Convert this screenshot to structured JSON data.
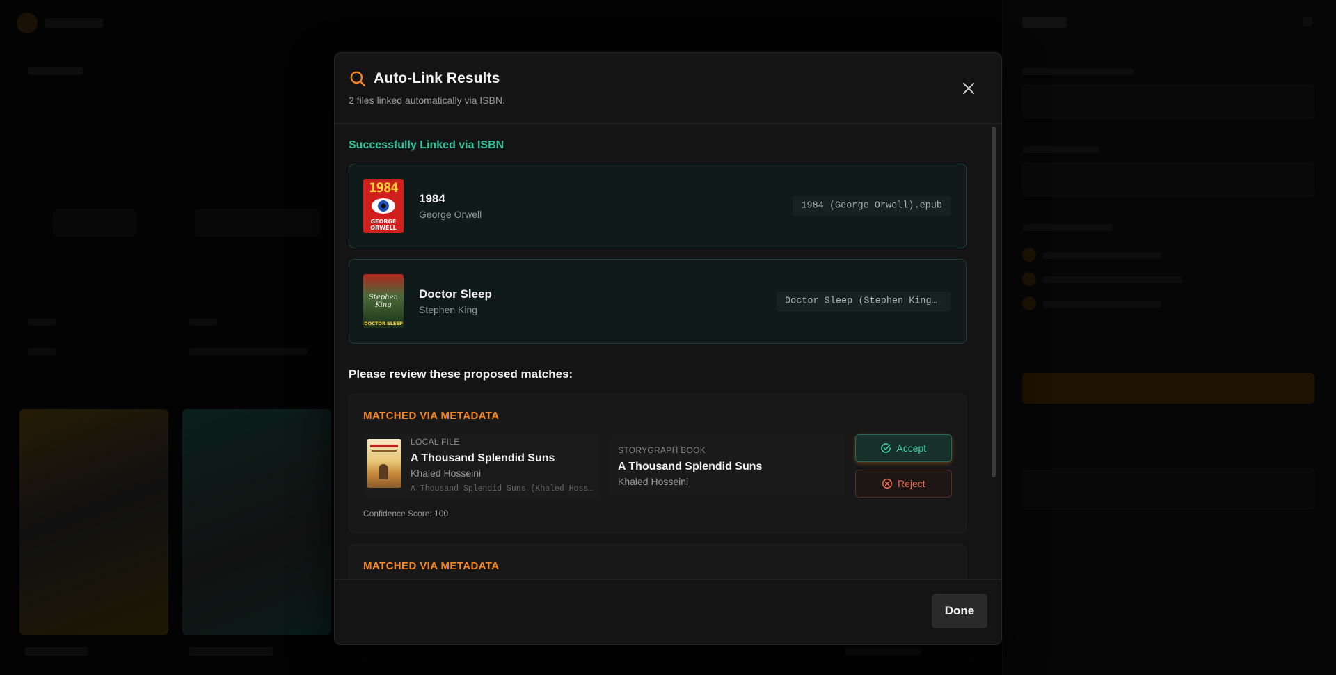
{
  "colors": {
    "accent": "#f5861f",
    "success": "#2fc29a",
    "reject": "#ef6b52"
  },
  "modal": {
    "title": "Auto-Link Results",
    "subtitle": "2 files linked automatically via ISBN.",
    "title_icon": "search-icon",
    "close_icon": "close-icon"
  },
  "linked": {
    "heading": "Successfully Linked via ISBN",
    "items": [
      {
        "title": "1984",
        "author": "George Orwell",
        "file": "1984 (George Orwell).epub",
        "cover_text_top": "1984",
        "cover_text_bottom": "GEORGE ORWELL"
      },
      {
        "title": "Doctor Sleep",
        "author": "Stephen King",
        "file": "Doctor Sleep (Stephen King).epub",
        "cover_text_top": "Stephen King",
        "cover_text_bottom": "DOCTOR SLEEP"
      }
    ]
  },
  "review": {
    "heading": "Please review these proposed matches:",
    "matches": [
      {
        "type": "MATCHED VIA METADATA",
        "local_label": "LOCAL FILE",
        "local_title": "A Thousand Splendid Suns",
        "local_author": "Khaled Hosseini",
        "local_file": "A Thousand Splendid Suns (Khaled Hosseini).epub",
        "sg_label": "STORYGRAPH BOOK",
        "sg_title": "A Thousand Splendid Suns",
        "sg_author": "Khaled Hosseini",
        "accept_label": "Accept",
        "reject_label": "Reject",
        "confidence": "Confidence Score: 100"
      },
      {
        "type": "MATCHED VIA METADATA"
      }
    ]
  },
  "footer": {
    "done_label": "Done"
  }
}
